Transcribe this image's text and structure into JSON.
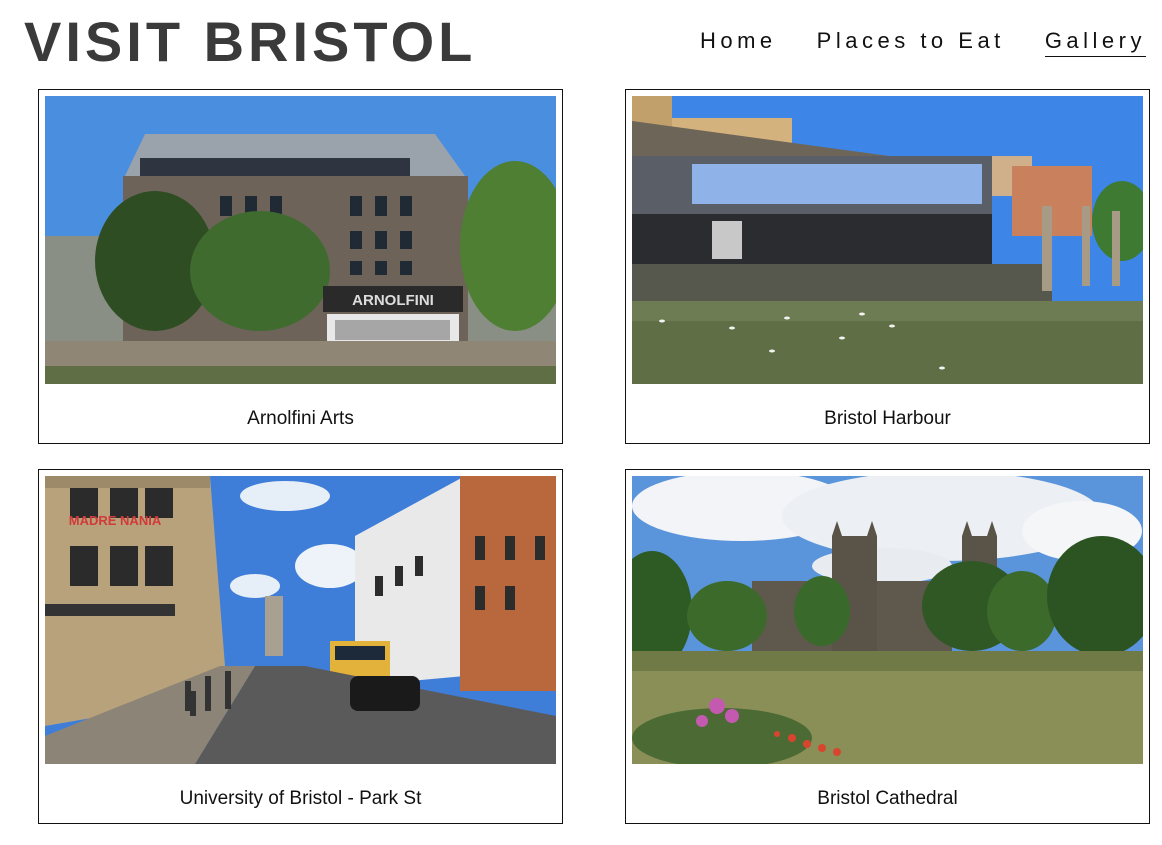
{
  "header": {
    "title": "VISIT BRISTOL",
    "nav": [
      {
        "label": "Home",
        "active": false
      },
      {
        "label": "Places to Eat",
        "active": false
      },
      {
        "label": "Gallery",
        "active": true
      }
    ]
  },
  "gallery": [
    {
      "caption": "Arnolfini Arts",
      "photo": "arnolfini-building-photo"
    },
    {
      "caption": "Bristol Harbour",
      "photo": "harbour-photo"
    },
    {
      "caption": "University of Bristol - Park St",
      "photo": "park-street-photo"
    },
    {
      "caption": "Bristol Cathedral",
      "photo": "cathedral-photo"
    }
  ],
  "photo_text": {
    "arnolfini_sign": "ARNOLFINI",
    "shop_sign": "MADRE NANIA"
  },
  "colors": {
    "sky": "#4a8ee0",
    "foliage": "#3f6b2f",
    "stone": "#6d6358",
    "water": "#5f6e45"
  }
}
